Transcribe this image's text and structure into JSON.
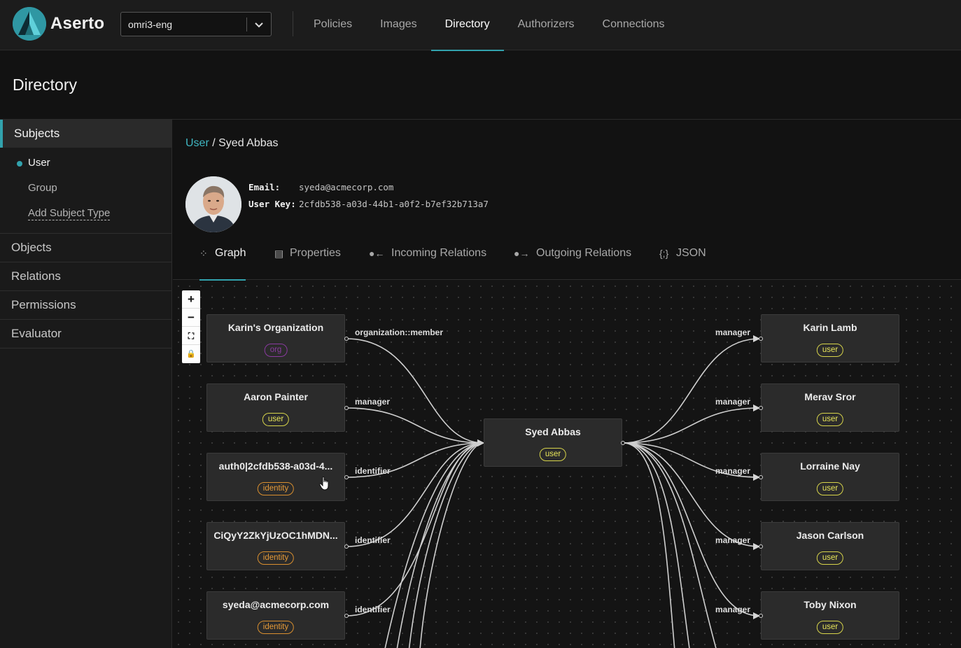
{
  "app": {
    "brand": "Aserto",
    "tenant": "omri3-eng",
    "nav": [
      "Policies",
      "Images",
      "Directory",
      "Authorizers",
      "Connections"
    ],
    "active_nav": "Directory"
  },
  "page": {
    "title": "Directory"
  },
  "sidebar": {
    "sections": [
      {
        "label": "Subjects",
        "active": true,
        "items": [
          {
            "label": "User",
            "active": true
          },
          {
            "label": "Group"
          },
          {
            "label": "Add Subject Type"
          }
        ]
      },
      {
        "label": "Objects"
      },
      {
        "label": "Relations"
      },
      {
        "label": "Permissions"
      },
      {
        "label": "Evaluator"
      }
    ]
  },
  "main": {
    "breadcrumb": {
      "link": "User",
      "separator": " / ",
      "current": "Syed Abbas"
    },
    "details": {
      "email_label": "Email:",
      "email_value": "syeda@acmecorp.com",
      "key_label": "User Key:",
      "key_value": "2cfdb538-a03d-44b1-a0f2-b7ef32b713a7"
    },
    "tabs": [
      {
        "label": "Graph",
        "icon": "graph-icon",
        "glyph": "⁘",
        "active": true
      },
      {
        "label": "Properties",
        "icon": "properties-icon",
        "glyph": "▤"
      },
      {
        "label": "Incoming Relations",
        "icon": "incoming-relations-icon",
        "glyph": "●←"
      },
      {
        "label": "Outgoing Relations",
        "icon": "outgoing-relations-icon",
        "glyph": "●→"
      },
      {
        "label": "JSON",
        "icon": "json-icon",
        "glyph": "{;}"
      }
    ]
  },
  "graph": {
    "controls": [
      "+",
      "−",
      "⛶",
      "🔒"
    ],
    "center": {
      "title": "Syed Abbas",
      "type": "user"
    },
    "incoming": [
      {
        "title": "Karin's Organization",
        "type": "org",
        "relation": "organization::member"
      },
      {
        "title": "Aaron Painter",
        "type": "user",
        "relation": "manager"
      },
      {
        "title": "auth0|2cfdb538-a03d-4...",
        "type": "identity",
        "relation": "identifier"
      },
      {
        "title": "CiQyY2ZkYjUzOC1hMDN...",
        "type": "identity",
        "relation": "identifier"
      },
      {
        "title": "syeda@acmecorp.com",
        "type": "identity",
        "relation": "identifier"
      }
    ],
    "outgoing": [
      {
        "title": "Karin Lamb",
        "type": "user",
        "relation": "manager"
      },
      {
        "title": "Merav Sror",
        "type": "user",
        "relation": "manager"
      },
      {
        "title": "Lorraine Nay",
        "type": "user",
        "relation": "manager"
      },
      {
        "title": "Jason Carlson",
        "type": "user",
        "relation": "manager"
      },
      {
        "title": "Toby Nixon",
        "type": "user",
        "relation": "manager"
      }
    ]
  },
  "colors": {
    "accent": "#32a2ad",
    "user_badge": "#d7d44a",
    "identity_badge": "#d98f2f",
    "org_badge": "#8a3aa0"
  }
}
